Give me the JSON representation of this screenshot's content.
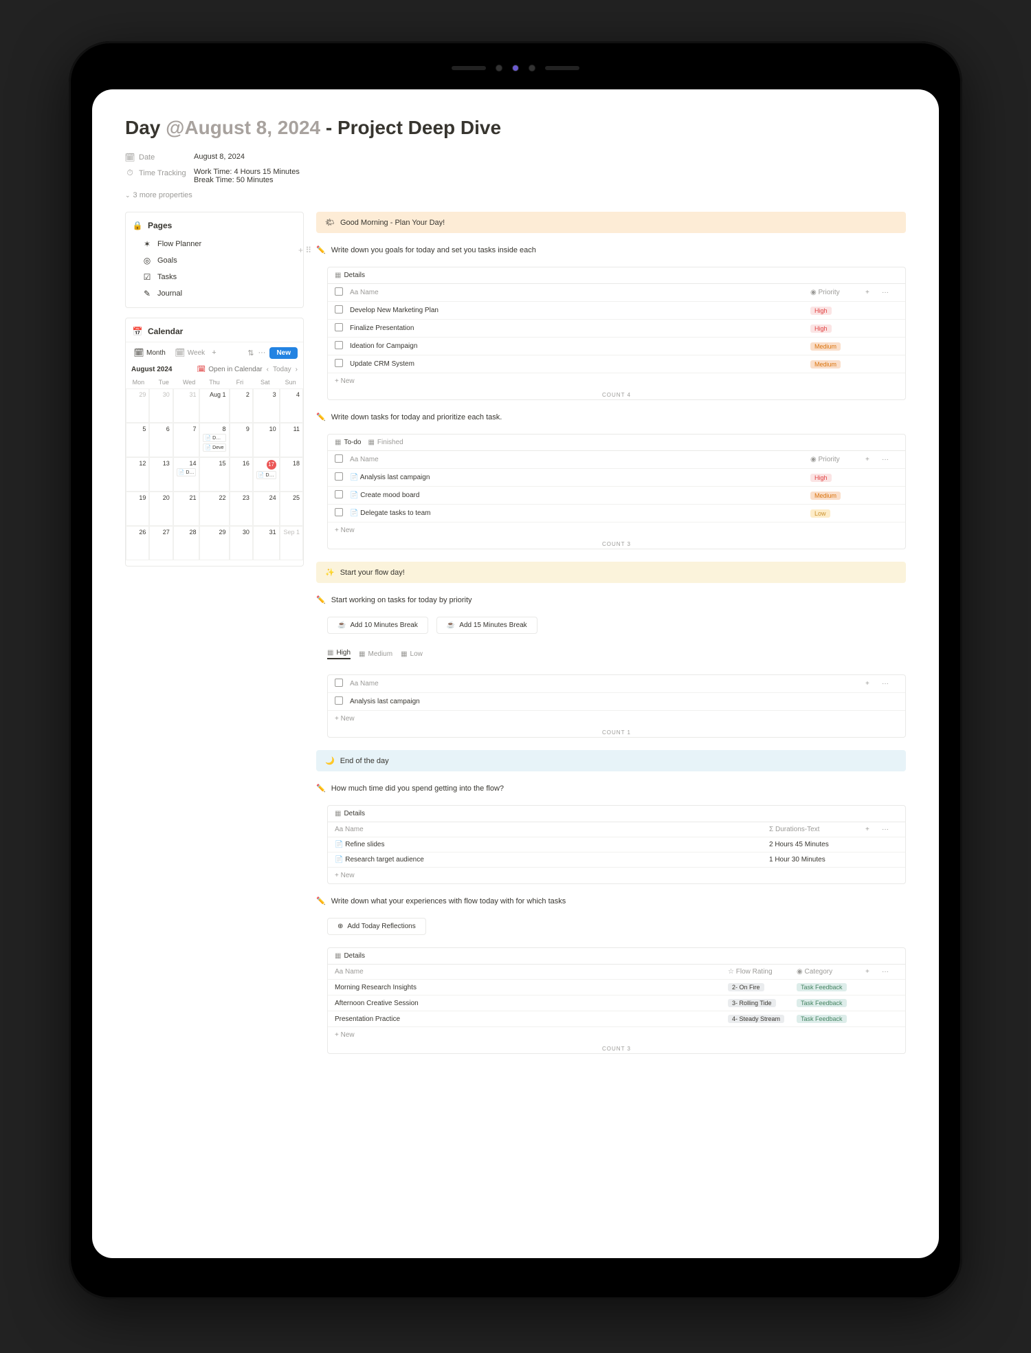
{
  "title": {
    "prefix": "Day ",
    "mention": "@August 8, 2024",
    "suffix": " - Project Deep Dive"
  },
  "props": {
    "date_label": "Date",
    "date_value": "August 8, 2024",
    "tracking_label": "Time Tracking",
    "tracking_line1": "Work Time: 4 Hours 15 Minutes",
    "tracking_line2": "Break Time: 50 Minutes",
    "more": "3 more properties"
  },
  "sidebar": {
    "pages_title": "Pages",
    "pages": [
      {
        "icon": "✶",
        "label": "Flow Planner"
      },
      {
        "icon": "◎",
        "label": "Goals"
      },
      {
        "icon": "☑",
        "label": "Tasks"
      },
      {
        "icon": "✎",
        "label": "Journal"
      }
    ],
    "calendar": {
      "title": "Calendar",
      "tab_month": "Month",
      "tab_week": "Week",
      "plus": "+",
      "new": "New",
      "filter": "⇅",
      "dots": "···",
      "month_label": "August 2024",
      "open_in_cal": "Open in Calendar",
      "prev": "‹",
      "today": "Today",
      "next": "›",
      "dow": [
        "Mon",
        "Tue",
        "Wed",
        "Thu",
        "Fri",
        "Sat",
        "Sun"
      ]
    }
  },
  "blocks": {
    "morning_callout": "Good Morning - Plan Your Day!",
    "goals_head": "Write down you goals for today and set you tasks inside each",
    "goals_tab": "Details",
    "goals_name_col": "Aa Name",
    "goals_priority_col": "Priority",
    "goals_items": [
      {
        "name": "Develop New Marketing Plan",
        "priority": "High",
        "pclass": "high"
      },
      {
        "name": "Finalize Presentation",
        "priority": "High",
        "pclass": "high"
      },
      {
        "name": "Ideation for Campaign",
        "priority": "Medium",
        "pclass": "medium"
      },
      {
        "name": "Update CRM System",
        "priority": "Medium",
        "pclass": "medium"
      }
    ],
    "goals_count": "COUNT 4",
    "tasks_head": "Write down tasks for today and prioritize each task.",
    "tasks_tab_todo": "To-do",
    "tasks_tab_done": "Finished",
    "tasks_name_col": "Aa Name",
    "tasks_priority_col": "Priority",
    "tasks_items": [
      {
        "name": "Analysis last campaign",
        "priority": "High",
        "pclass": "high"
      },
      {
        "name": "Create mood board",
        "priority": "Medium",
        "pclass": "medium"
      },
      {
        "name": "Delegate tasks to team",
        "priority": "Low",
        "pclass": "low"
      }
    ],
    "tasks_count": "COUNT 3",
    "start_callout": "Start your flow day!",
    "start_head": "Start working on tasks for today by priority",
    "break10": "Add 10 Minutes Break",
    "break15": "Add 15 Minutes Break",
    "tab_high": "High",
    "tab_medium": "Medium",
    "tab_low": "Low",
    "start_name_col": "Aa Name",
    "start_items": [
      {
        "name": "Analysis last campaign"
      }
    ],
    "start_count": "COUNT 1",
    "end_callout": "End of the day",
    "end_head": "How much time did you spend getting into the flow?",
    "end_tab": "Details",
    "end_name_col": "Aa Name",
    "end_dur_col": "Durations-Text",
    "end_items": [
      {
        "name": "Refine slides",
        "dur": "2 Hours 45 Minutes"
      },
      {
        "name": "Research target audience",
        "dur": "1 Hour 30 Minutes"
      }
    ],
    "refl_head": "Write down what your experiences with flow today with for which tasks",
    "refl_btn": "Add Today Reflections",
    "refl_tab": "Details",
    "refl_name_col": "Aa Name",
    "refl_rating_col": "Flow Rating",
    "refl_cat_col": "Category",
    "refl_items": [
      {
        "name": "Morning Research Insights",
        "rating": "2- On Fire",
        "cat": "Task Feedback"
      },
      {
        "name": "Afternoon Creative Session",
        "rating": "3- Rolling Tide",
        "cat": "Task Feedback"
      },
      {
        "name": "Presentation Practice",
        "rating": "4- Steady Stream",
        "cat": "Task Feedback"
      }
    ],
    "refl_count": "COUNT 3",
    "new_label": "+ New"
  }
}
